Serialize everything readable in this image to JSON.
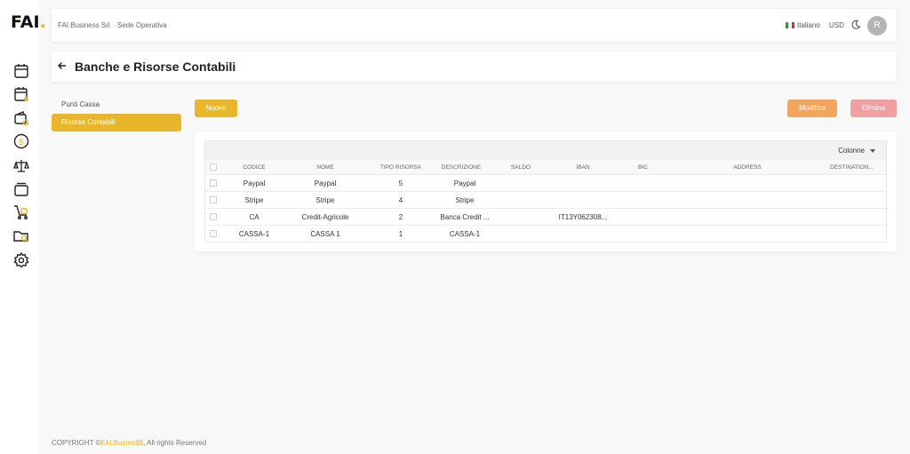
{
  "app": {
    "logo_text": "FAI",
    "logo_dot": ".",
    "accent_color": "#e8b62a"
  },
  "sidebar": {
    "items": [
      {
        "icon": "calendar-icon"
      },
      {
        "icon": "calendar-alert-icon"
      },
      {
        "icon": "wallet-coins-icon"
      },
      {
        "icon": "dollar-circle-icon"
      },
      {
        "icon": "scale-icon"
      },
      {
        "icon": "layers-icon"
      },
      {
        "icon": "cart-icon"
      },
      {
        "icon": "folder-search-icon"
      },
      {
        "icon": "gear-icon"
      }
    ]
  },
  "header": {
    "company": "FAI.Business Srl",
    "branch": "Sede Operativa",
    "language": "Italiano",
    "currency": "USD",
    "avatar_initial": "R"
  },
  "page": {
    "title": "Banche e Risorse Contabili"
  },
  "submenu": {
    "items": [
      {
        "label": "Punti Cassa"
      },
      {
        "label": "Risorse Contabili"
      }
    ]
  },
  "actions": {
    "new_label": "Nuovo",
    "edit_label": "Modifica",
    "delete_label": "Elimina"
  },
  "table": {
    "columns_button": "Colonne",
    "headers": [
      "CODICE",
      "NOME",
      "TIPO RISORSA",
      "DESCRIZIONE",
      "SALDO",
      "IBAN",
      "BIC",
      "ADDRESS",
      "DESTINATION..."
    ],
    "rows": [
      [
        "Paypal",
        "Paypal",
        "5",
        "Paypal",
        "",
        "",
        "",
        "",
        ""
      ],
      [
        "Stripe",
        "Stripe",
        "4",
        "Stripe",
        "",
        "",
        "",
        "",
        ""
      ],
      [
        "CA",
        "Credit-Agricole",
        "2",
        "Banca Credit ...",
        "",
        "IT13Y062308...",
        "",
        "",
        ""
      ],
      [
        "CASSA-1",
        "CASSA 1",
        "1",
        "CASSA-1",
        "",
        "",
        "",
        "",
        ""
      ]
    ]
  },
  "footer": {
    "prefix": "COPYRIGHT ©",
    "brand": "FAI.Busine$$",
    "suffix": ", All rights Reserved"
  }
}
